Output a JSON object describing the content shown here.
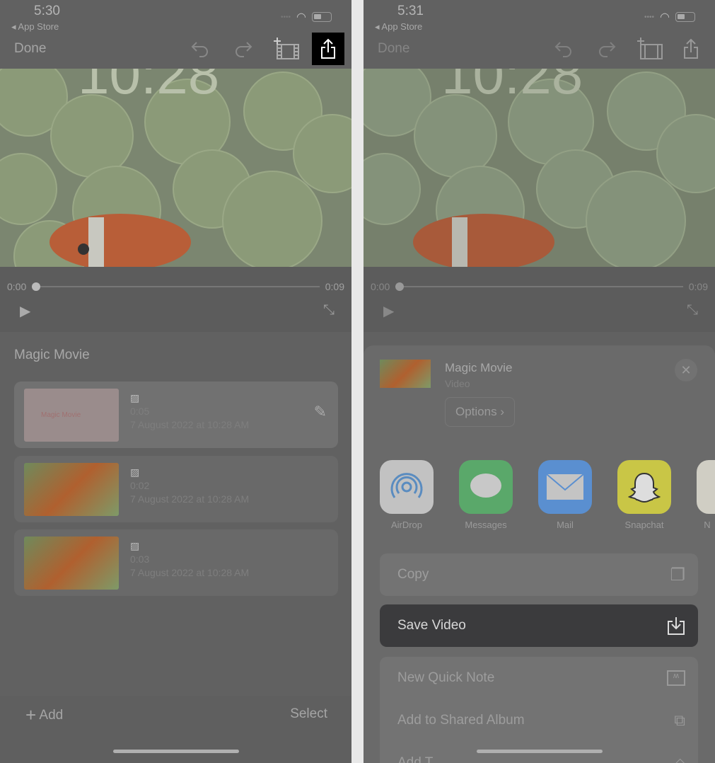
{
  "left": {
    "status": {
      "time": "5:30",
      "back": "App Store"
    },
    "toolbar": {
      "done": "Done"
    },
    "player": {
      "current": "0:00",
      "total": "0:09",
      "progress": 0
    },
    "project_title": "Magic Movie",
    "clips": [
      {
        "duration": "0:05",
        "date": "7 August 2022 at 10:28 AM",
        "thumb_title": "Magic Movie",
        "editable": true
      },
      {
        "duration": "0:02",
        "date": "7 August 2022 at 10:28 AM"
      },
      {
        "duration": "0:03",
        "date": "7 August 2022 at 10:28 AM"
      }
    ],
    "footer": {
      "add": "Add",
      "select": "Select"
    }
  },
  "right": {
    "status": {
      "time": "5:31",
      "back": "App Store"
    },
    "toolbar": {
      "done": "Done"
    },
    "player": {
      "current": "0:00",
      "total": "0:09",
      "progress": 0
    },
    "share": {
      "title": "Magic Movie",
      "subtitle": "Video",
      "options": "Options",
      "apps": [
        {
          "label": "AirDrop",
          "color": "#c9c9c9"
        },
        {
          "label": "Messages",
          "color": "#5aa86a"
        },
        {
          "label": "Mail",
          "color": "#5a8fd0"
        },
        {
          "label": "Snapchat",
          "color": "#cfcb4a"
        },
        {
          "label": "N",
          "color": "#d8d6cc"
        }
      ],
      "actions": [
        {
          "label": "Copy",
          "icon": "copy-icon"
        },
        {
          "label": "Save Video",
          "icon": "save-icon",
          "highlighted": true
        },
        {
          "label": "New Quick Note",
          "icon": "quick-note-icon"
        },
        {
          "label": "Add to Shared Album",
          "icon": "shared-album-icon"
        },
        {
          "label": "Add T",
          "icon": "tag-icon"
        }
      ]
    }
  },
  "colors": {
    "highlight_share": "#000000",
    "save_row": "#3b3b3d"
  }
}
